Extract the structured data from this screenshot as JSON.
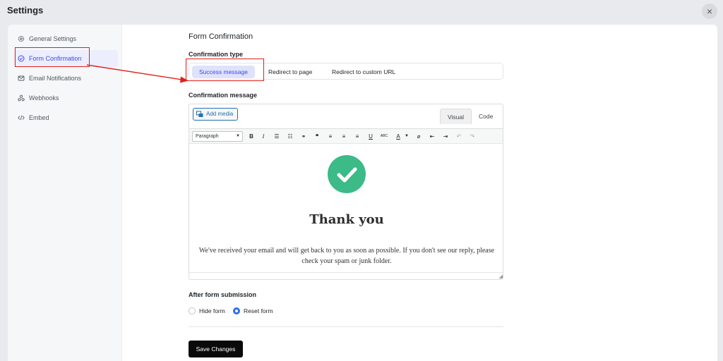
{
  "window": {
    "title": "Settings",
    "close_icon": "×"
  },
  "sidebar": {
    "items": [
      {
        "label": "General Settings",
        "icon": "gear-icon"
      },
      {
        "label": "Form Confirmation",
        "icon": "check-circle-icon",
        "active": true
      },
      {
        "label": "Email Notifications",
        "icon": "envelope-icon"
      },
      {
        "label": "Webhooks",
        "icon": "webhook-icon"
      },
      {
        "label": "Embed",
        "icon": "code-icon"
      }
    ]
  },
  "main": {
    "section_title": "Form Confirmation",
    "confirmation_type": {
      "label": "Confirmation type",
      "options": [
        "Success message",
        "Redirect to page",
        "Redirect to custom URL"
      ],
      "selected": "Success message"
    },
    "confirmation_message": {
      "label": "Confirmation message",
      "add_media_label": "Add media",
      "tabs": [
        "Visual",
        "Code"
      ],
      "active_tab": "Visual",
      "format_select": "Paragraph",
      "content_heading": "Thank you",
      "content_text": "We've received your email and will get back to you as soon as possible. If you don't see our reply, please check your spam or junk folder."
    },
    "after_submission": {
      "label": "After form submission",
      "options": [
        "Hide form",
        "Reset form"
      ],
      "selected": "Reset form"
    },
    "save_label": "Save Changes"
  },
  "colors": {
    "accent": "#3b4be8",
    "success": "#3cba87",
    "annotation": "#e0201a",
    "radio": "#2f6fec"
  }
}
